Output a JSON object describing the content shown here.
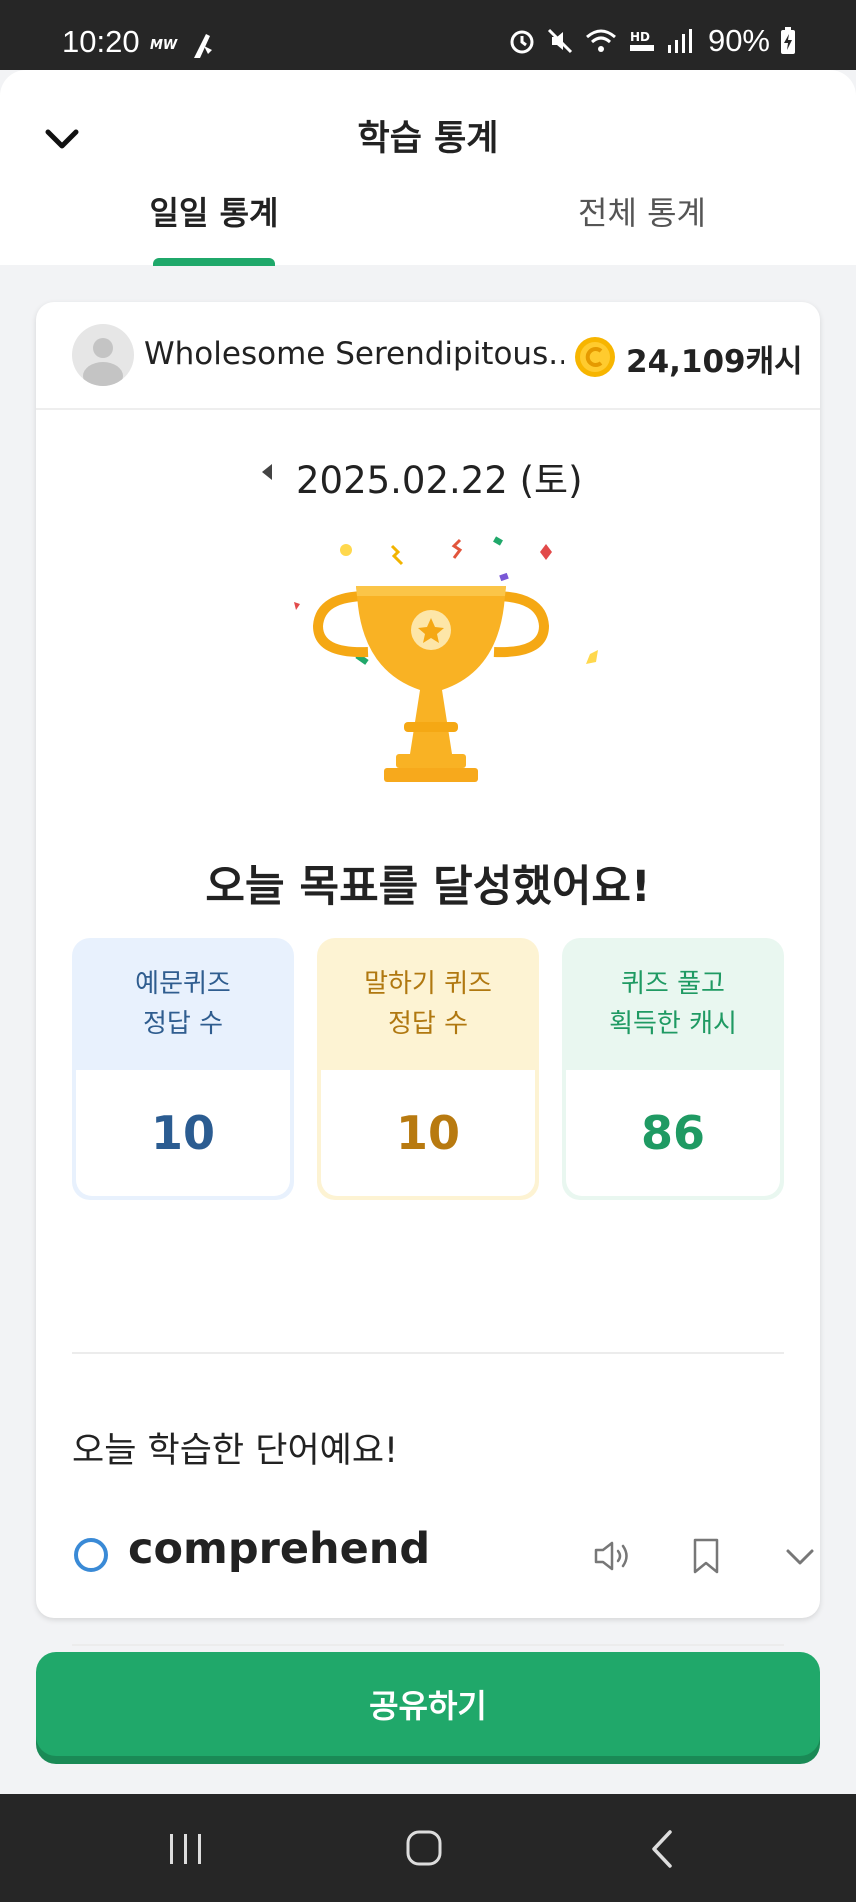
{
  "status_bar": {
    "time": "10:20",
    "carrier": "MW",
    "battery": "90%",
    "icons": [
      "alarm-icon",
      "mute-icon",
      "wifi-icon",
      "hd-voice-icon",
      "signal-icon",
      "battery-icon"
    ]
  },
  "header": {
    "title": "학습 통계",
    "tabs": [
      {
        "label": "일일 통계",
        "active": true
      },
      {
        "label": "전체 통계",
        "active": false
      }
    ]
  },
  "profile": {
    "username": "Wholesome Serendipitous...",
    "cash": "24,109캐시"
  },
  "date": {
    "label": "2025.02.22 (토)"
  },
  "goal_message": "오늘 목표를 달성했어요!",
  "stats": [
    {
      "label": "예문퀴즈\n정답 수",
      "value": "10",
      "color": "#2b5c91"
    },
    {
      "label": "말하기 퀴즈\n정답 수",
      "value": "10",
      "color": "#b87a10"
    },
    {
      "label": "퀴즈 풀고\n획득한 캐시",
      "value": "86",
      "color": "#1f9a63"
    }
  ],
  "words_section": {
    "title": "오늘 학습한 단어예요!",
    "words": [
      {
        "word": "comprehend"
      }
    ]
  },
  "share_button": "공유하기",
  "colors": {
    "accent": "#20a86a",
    "tab_indicator": "#1fa86a"
  }
}
